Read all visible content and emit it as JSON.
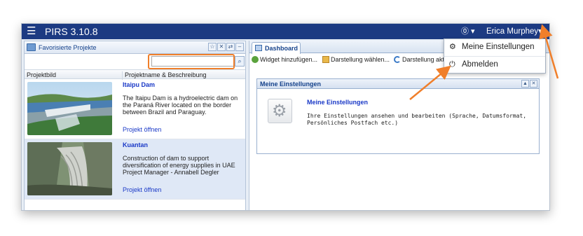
{
  "app": {
    "title": "PIRS 3.10.8",
    "menu_icon": "hamburger-icon"
  },
  "header": {
    "help_label": "⓪ ▾",
    "user_label": "Erica Murphey▾"
  },
  "left_panel": {
    "title": "Favorisierte Projekte",
    "search": {
      "placeholder": "",
      "value": ""
    },
    "columns": [
      "Projektbild",
      "Projektname & Beschreibung"
    ],
    "projects": [
      {
        "name": "Itaipu Dam",
        "description": "The Itaipu Dam is a hydroelectric dam on the Paraná River located on the border between Brazil and Paraguay.",
        "link": "Projekt öffnen"
      },
      {
        "name": "Kuantan",
        "description": "Construction of dam to support diversification of energy supplies in UAE Project Manager - Annabell Degler",
        "link": "Projekt öffnen"
      }
    ]
  },
  "dashboard": {
    "tab_label": "Dashboard",
    "toolbar": {
      "add_widget": "Widget hinzufügen...",
      "choose_view": "Darstellung wählen...",
      "refresh_view": "Darstellung akt"
    },
    "widget": {
      "header": "Meine Einstellungen",
      "title": "Meine Einstellungen",
      "description": "Ihre Einstellungen ansehen und bearbeiten (Sprache, Datumsformat, Persönliches Postfach etc.)"
    }
  },
  "user_menu": {
    "items": [
      {
        "label": "Meine Einstellungen",
        "icon": "gear-icon"
      },
      {
        "label": "Abmelden",
        "icon": "power-icon"
      }
    ]
  },
  "colors": {
    "titlebar": "#1c3a82",
    "link": "#1a39c7",
    "highlight": "#f07f2b"
  }
}
